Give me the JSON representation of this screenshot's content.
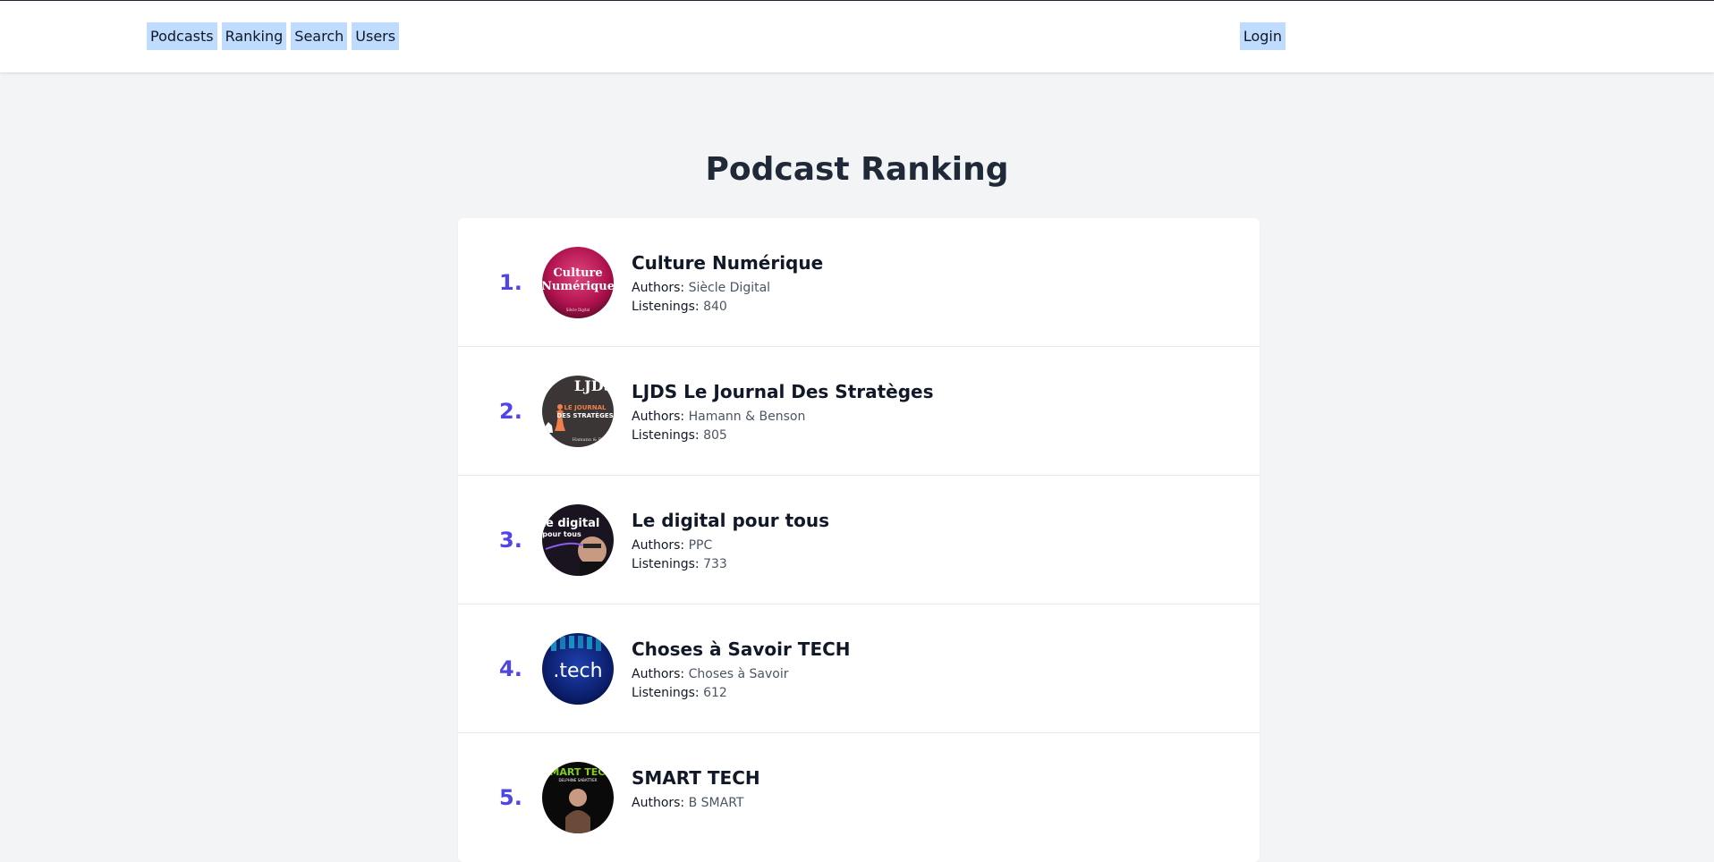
{
  "nav": {
    "links": [
      "Podcasts",
      "Ranking",
      "Search",
      "Users"
    ],
    "login_label": "Login"
  },
  "page": {
    "title": "Podcast Ranking"
  },
  "labels": {
    "authors": "Authors:",
    "listenings": "Listenings:"
  },
  "podcasts": [
    {
      "rank": "1.",
      "title": "Culture Numérique",
      "authors": "Siècle Digital",
      "listenings": "840",
      "cover_text": "Culture Numérique",
      "icon": "culture-numerique-cover"
    },
    {
      "rank": "2.",
      "title": "LJDS Le Journal Des Stratèges",
      "authors": "Hamann & Benson",
      "listenings": "805",
      "cover_text": "LJDS",
      "icon": "ljds-cover"
    },
    {
      "rank": "3.",
      "title": "Le digital pour tous",
      "authors": "PPC",
      "listenings": "733",
      "cover_text": "Le digital pour tous",
      "icon": "digital-pour-tous-cover"
    },
    {
      "rank": "4.",
      "title": "Choses à Savoir TECH",
      "authors": "Choses à Savoir",
      "listenings": "612",
      "cover_text": ".tech",
      "icon": "tech-cover"
    },
    {
      "rank": "5.",
      "title": "SMART TECH",
      "authors": "B SMART",
      "listenings": "",
      "cover_text": "SMART TECH",
      "icon": "smart-tech-cover"
    }
  ],
  "colors": {
    "accent": "#4f46e5",
    "nav_button": "#bfdbfe",
    "background": "#f3f4f6"
  }
}
